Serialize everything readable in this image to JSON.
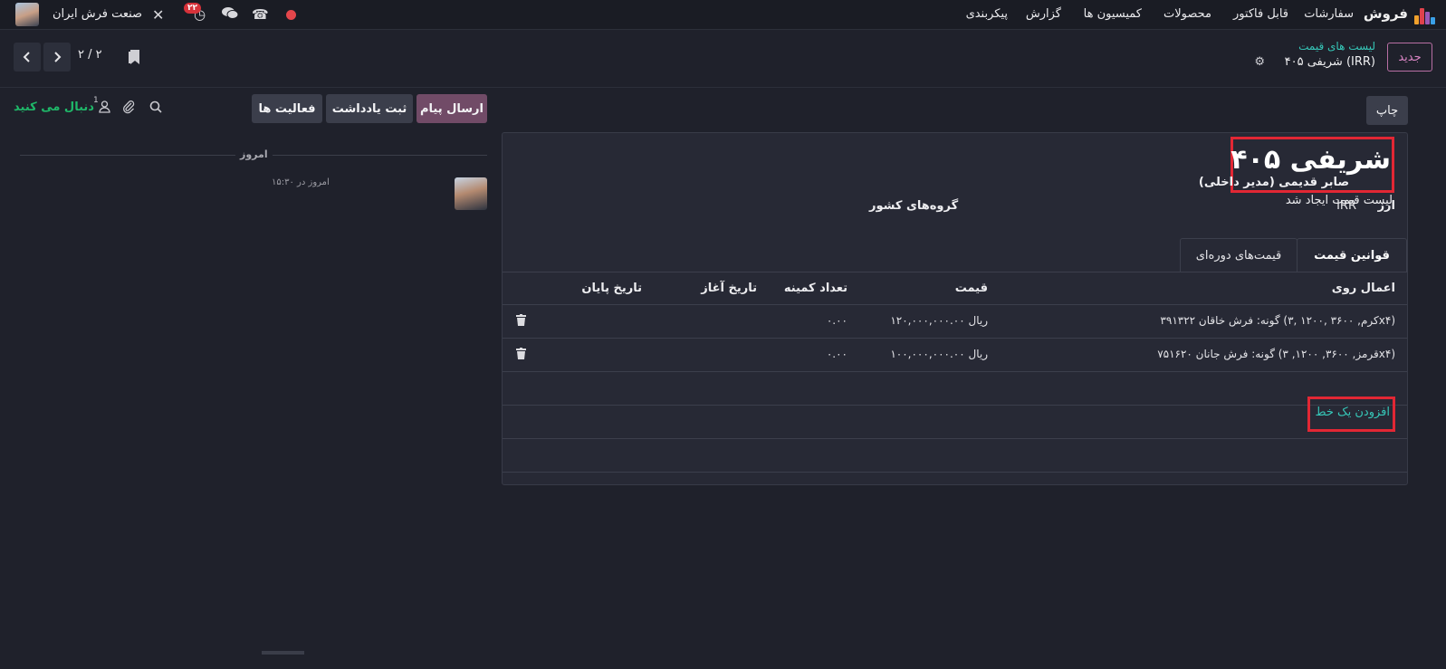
{
  "navbar": {
    "brand": "فروش",
    "menu": [
      "سفارشات",
      "قابل فاکتور",
      "محصولات",
      "کمیسیون ها",
      "گزارش",
      "پیکربندی"
    ],
    "activity_count": "۲۲",
    "company": "صنعت فرش ایران",
    "icons": [
      "apps-icon",
      "record-dot-icon",
      "phone-icon",
      "chat-icon",
      "activity-clock-icon",
      "tools-icon",
      "user-avatar"
    ]
  },
  "control_panel": {
    "new_button": "جدید",
    "breadcrumb_link": "لیست های قیمت",
    "breadcrumb_current": "شریفی ۴۰۵ (IRR)",
    "pager_value": "۲ / ۲"
  },
  "form": {
    "print_button": "چاپ",
    "title": "شریفی ۴۰۵",
    "currency_label": "ارز",
    "currency_value": "IRR",
    "country_groups_label": "گروه‌های کشور",
    "tabs": [
      "قوانین قیمت",
      "قیمت‌های دوره‌ای"
    ],
    "columns": [
      "اعمال روی",
      "قیمت",
      "تعداد کمینه",
      "تاریخ آغاز",
      "تاریخ پایان"
    ],
    "rows": [
      {
        "apply_on": "گونه: فرش خاقان ۳۹۱۳۲۲ (کرم, ۳۶۰۰ ,۱۲۰۰ ,۳x۴)",
        "price": "۱۲۰,۰۰۰,۰۰۰.۰۰ ریال",
        "min_qty": "۰.۰۰"
      },
      {
        "apply_on": "گونه: فرش جانان ۷۵۱۶۲۰ (قرمز, ۳۶۰۰, ۱۲۰۰, ۳x۴)",
        "price": "۱۰۰,۰۰۰,۰۰۰.۰۰ ریال",
        "min_qty": "۰.۰۰"
      }
    ],
    "add_line": "افزودن یک خط"
  },
  "chatter": {
    "send_message": "ارسال پیام",
    "log_note": "ثبت یادداشت",
    "activities": "فعالیت ها",
    "followers_count": "1",
    "follow": "دنبال می کنید",
    "today": "امروز",
    "message": {
      "author": "صابر قدیمی (مدیر داخلی)",
      "time": "امروز در ۱۵:۳۰",
      "body": "لیست قیمت ایجاد شد"
    }
  },
  "colors": {
    "background": "#1f212b",
    "accent_teal": "#36c7b8",
    "primary_purple": "#714b67",
    "highlight_red": "#e22734",
    "follow_green": "#1fb869"
  }
}
